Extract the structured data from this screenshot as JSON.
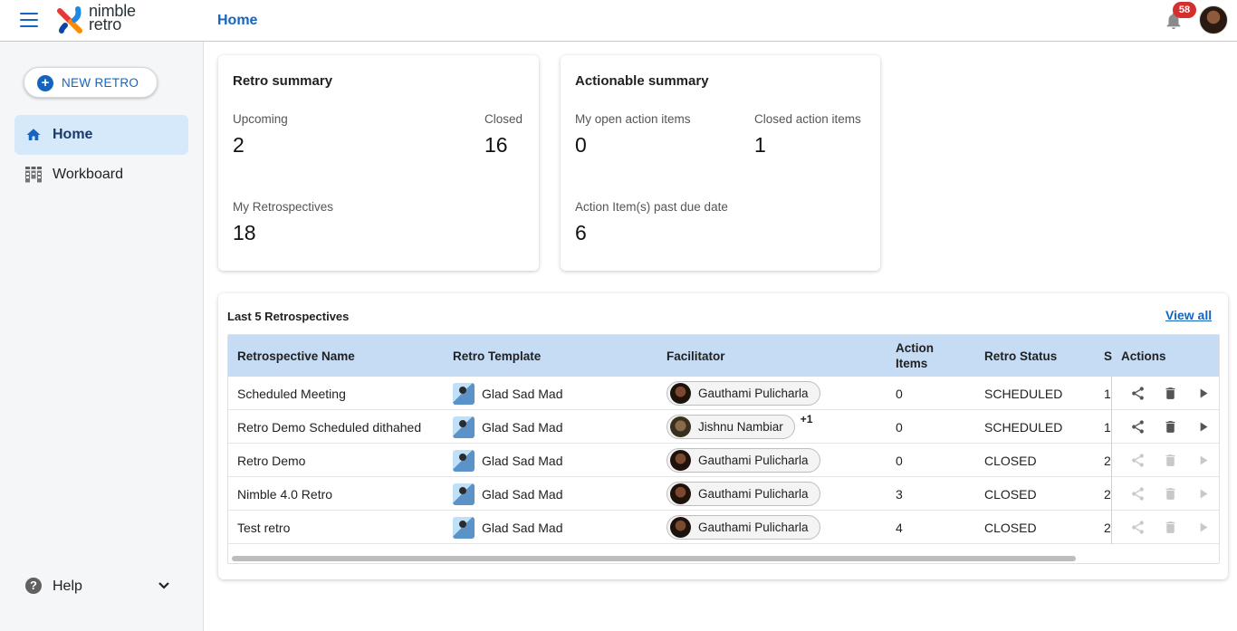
{
  "header": {
    "logo_line1": "nimble",
    "logo_line2": "retro",
    "page_title": "Home",
    "notification_count": "58"
  },
  "sidebar": {
    "new_retro_label": "NEW RETRO",
    "items": [
      {
        "label": "Home",
        "icon": "home-icon",
        "active": true
      },
      {
        "label": "Workboard",
        "icon": "workboard-icon",
        "active": false
      }
    ],
    "help_label": "Help"
  },
  "retro_summary": {
    "title": "Retro summary",
    "upcoming_label": "Upcoming",
    "upcoming_value": "2",
    "closed_label": "Closed",
    "closed_value": "16",
    "my_retros_label": "My Retrospectives",
    "my_retros_value": "18"
  },
  "actionable_summary": {
    "title": "Actionable summary",
    "open_label": "My open action items",
    "open_value": "0",
    "closed_label": "Closed action items",
    "closed_value": "1",
    "past_due_label": "Action Item(s) past due date",
    "past_due_value": "6"
  },
  "last_retros": {
    "title": "Last 5 Retrospectives",
    "view_all": "View all",
    "columns": [
      "Retrospective Name",
      "Retro Template",
      "Facilitator",
      "Action Items",
      "Retro Status",
      "S",
      "Actions"
    ],
    "rows": [
      {
        "name": "Scheduled Meeting",
        "template": "Glad Sad Mad",
        "facilitator": "Gauthami Pulicharla",
        "extra": "",
        "action_items": "0",
        "status": "SCHEDULED",
        "s": "1",
        "enabled": true
      },
      {
        "name": "Retro Demo Scheduled dithahed",
        "template": "Glad Sad Mad",
        "facilitator": "Jishnu Nambiar",
        "extra": "+1",
        "action_items": "0",
        "status": "SCHEDULED",
        "s": "1",
        "enabled": true
      },
      {
        "name": "Retro Demo",
        "template": "Glad Sad Mad",
        "facilitator": "Gauthami Pulicharla",
        "extra": "",
        "action_items": "0",
        "status": "CLOSED",
        "s": "2",
        "enabled": false
      },
      {
        "name": "Nimble 4.0 Retro",
        "template": "Glad Sad Mad",
        "facilitator": "Gauthami Pulicharla",
        "extra": "",
        "action_items": "3",
        "status": "CLOSED",
        "s": "2",
        "enabled": false
      },
      {
        "name": "Test retro",
        "template": "Glad Sad Mad",
        "facilitator": "Gauthami Pulicharla",
        "extra": "",
        "action_items": "4",
        "status": "CLOSED",
        "s": "2",
        "enabled": false
      }
    ]
  },
  "colors": {
    "accent": "#1565c0",
    "table_header": "#c5dcf4",
    "active_nav": "#d6e9fb",
    "badge": "#d32f2f"
  }
}
